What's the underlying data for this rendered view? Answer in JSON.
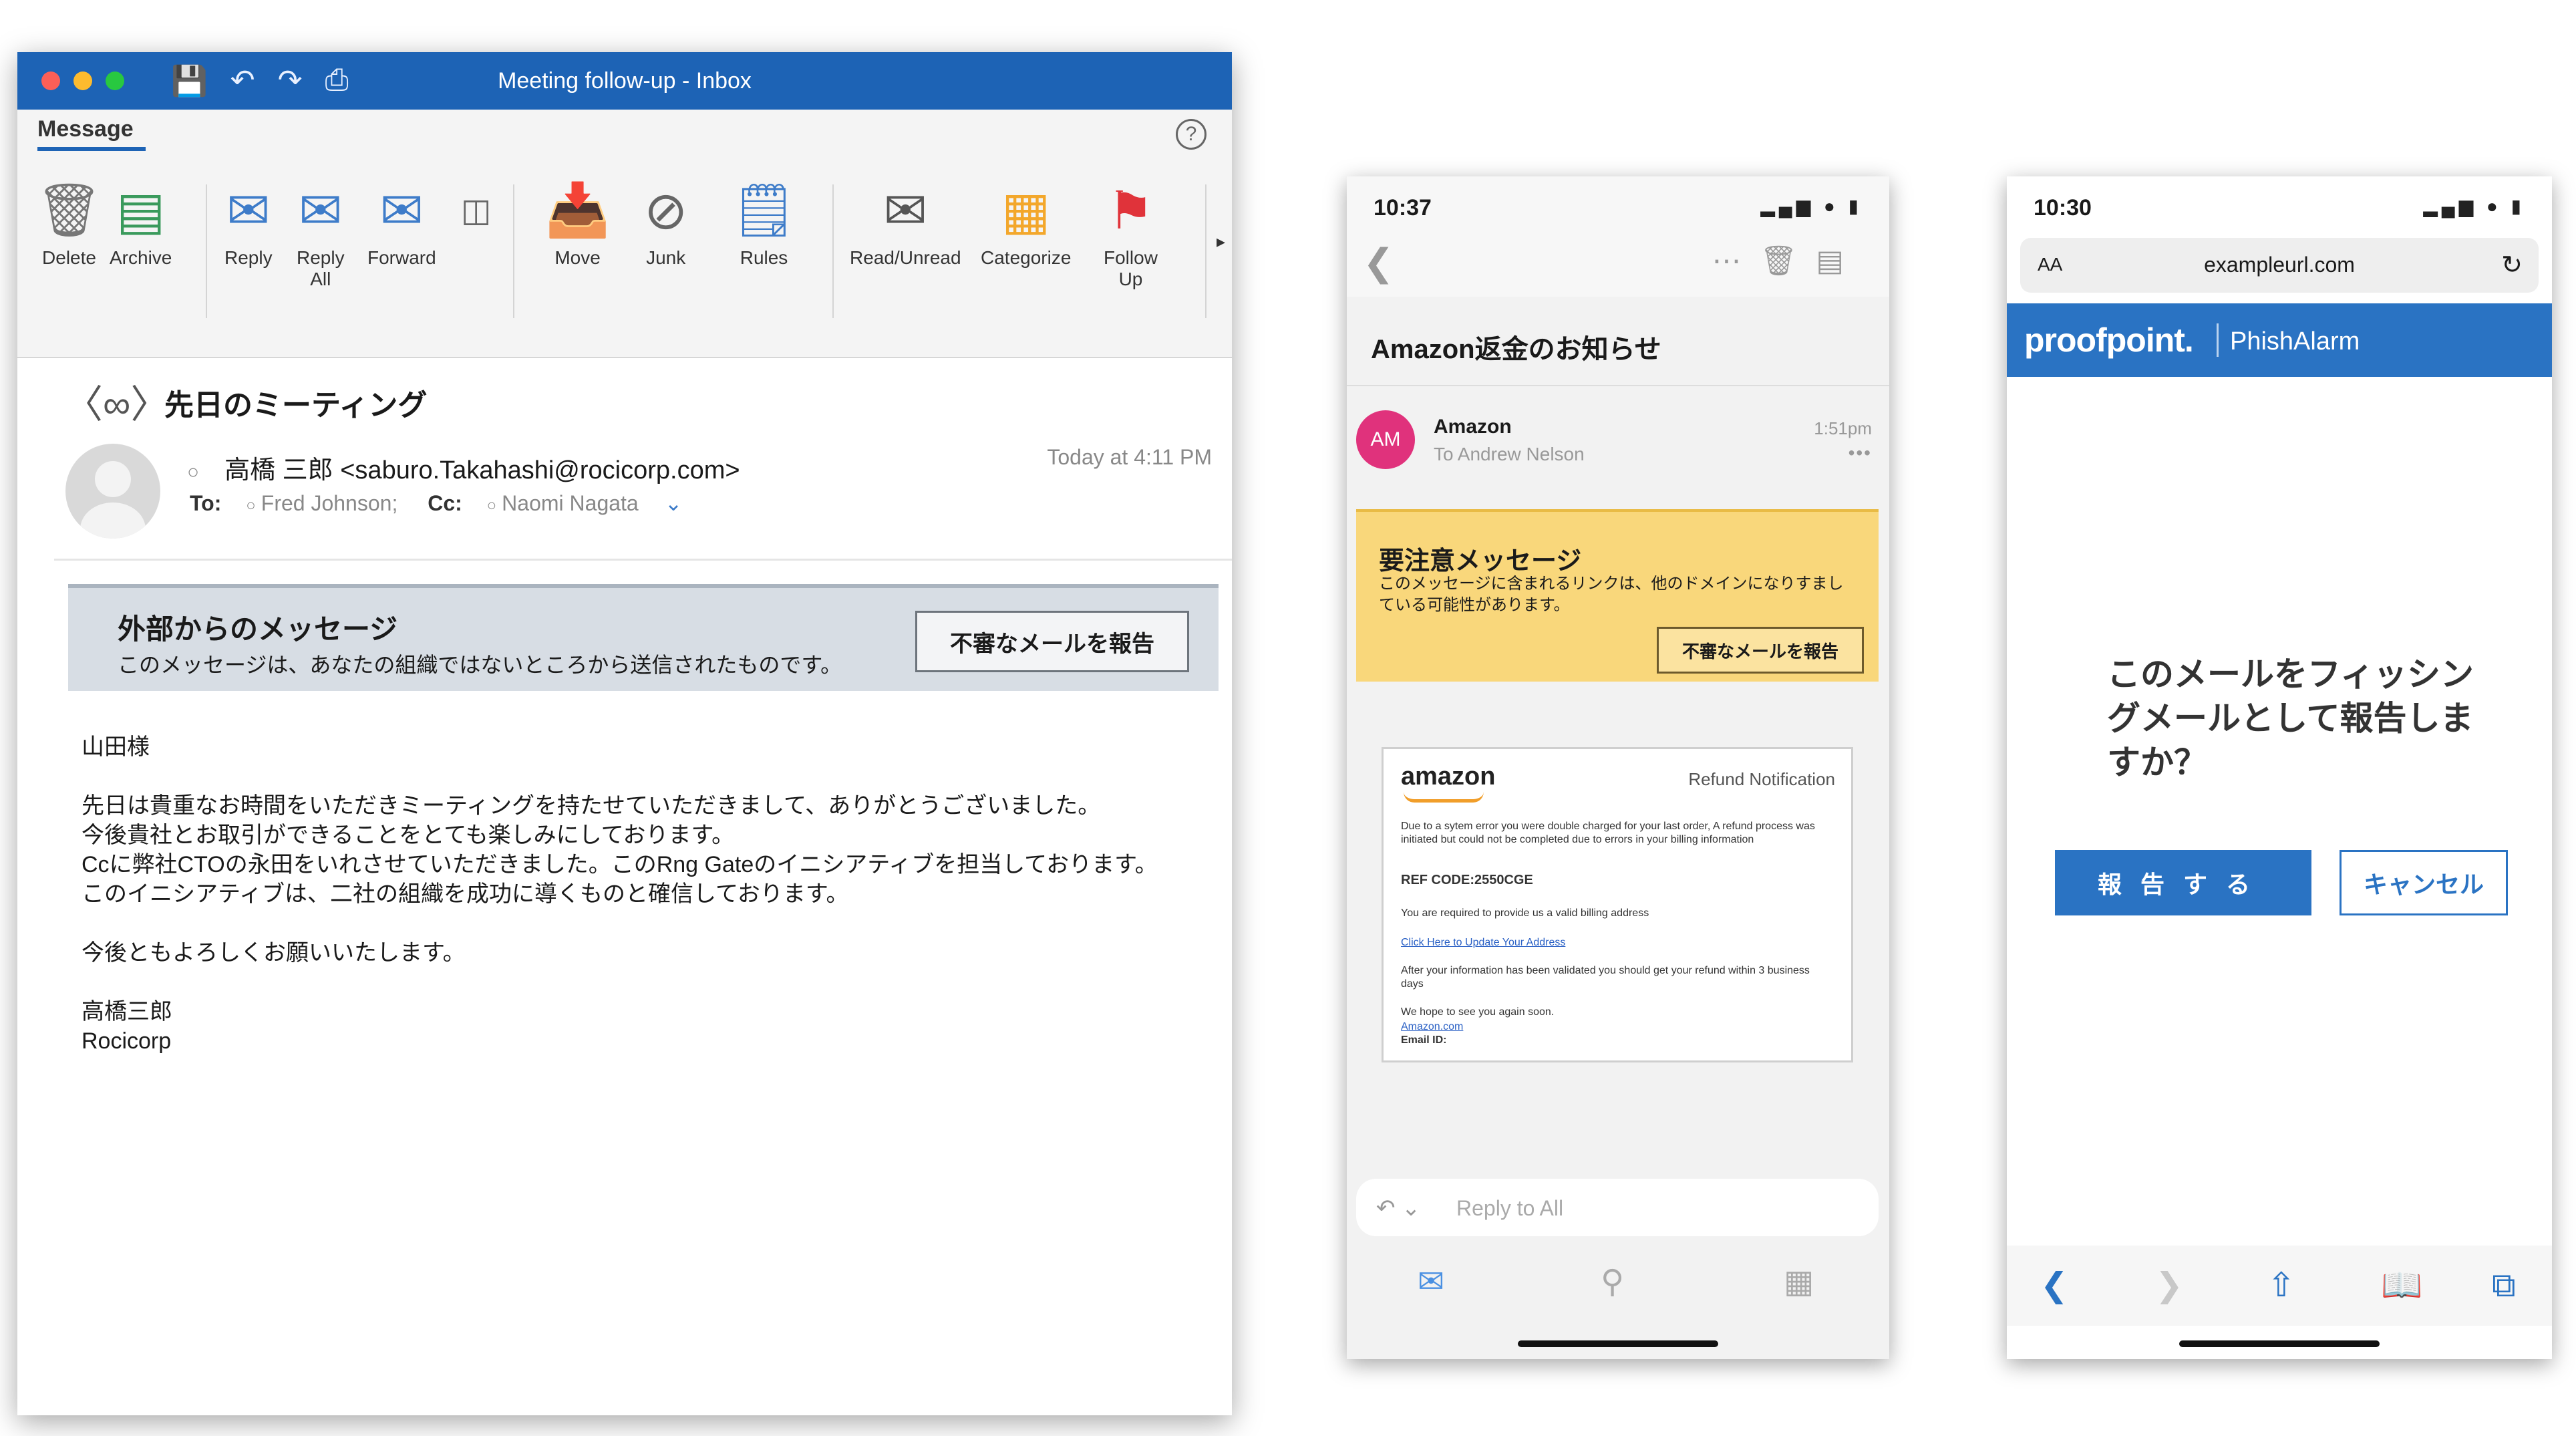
{
  "outlook": {
    "window_title": "Meeting follow-up - Inbox",
    "tab_message": "Message",
    "ribbon": {
      "delete": "Delete",
      "archive": "Archive",
      "reply": "Reply",
      "reply_all_1": "Reply",
      "reply_all_2": "All",
      "forward": "Forward",
      "move": "Move",
      "junk": "Junk",
      "rules": "Rules",
      "read_unread": "Read/Unread",
      "categorize": "Categorize",
      "follow_up_1": "Follow",
      "follow_up_2": "Up"
    },
    "subject": "先日のミーティング",
    "sender": "高橋 三郎 <saburo.Takahashi@rocicorp.com>",
    "to_label": "To:",
    "to_name": "Fred Johnson;",
    "cc_label": "Cc:",
    "cc_name": "Naomi Nagata",
    "date": "Today at 4:11 PM",
    "banner": {
      "title": "外部からのメッセージ",
      "text": "このメッセージは、あなたの組織ではないところから送信されたものです。",
      "button": "不審なメールを報告"
    },
    "body": {
      "greeting": "山田様",
      "line1": "先日は貴重なお時間をいただきミーティングを持たせていただきまして、ありがとうございました。",
      "line2": "今後貴社とお取引ができることをとても楽しみにしております。",
      "line3": "Ccに弊社CTOの永田をいれさせていただきました。このRng Gateのイニシアティブを担当しております。",
      "line4": "このイニシアティブは、二社の組織を成功に導くものと確信しております。",
      "closing": "今後ともよろしくお願いいたします。",
      "sig_name": "高橋三郎",
      "sig_company": "Rocicorp"
    }
  },
  "phone1": {
    "time": "10:37",
    "subject": "Amazon返金のお知らせ",
    "avatar_initials": "AM",
    "from": "Amazon",
    "to": "To Andrew Nelson",
    "time_received": "1:51pm",
    "warning": {
      "title": "要注意メッセージ",
      "text": "このメッセージに含まれるリンクは、他のドメインになりすましている可能性があります。",
      "button": "不審なメールを報告"
    },
    "email_card": {
      "logo": "amazon",
      "header": "Refund Notification",
      "p1": "Due to a sytem error you were double charged for your last order, A refund process was initiated but could not be completed due to errors in your billing information",
      "ref": "REF CODE:2550CGE",
      "p2": "You are required to provide us a valid billing address",
      "link": "Click Here to Update Your Address",
      "p3": "After your information has been validated you should get your refund within 3 business days",
      "p4": "We hope to see you again soon.",
      "sig": "Amazon.com",
      "email_label": "Email ID:"
    },
    "reply_label": "Reply to All"
  },
  "phone2": {
    "time": "10:30",
    "aa": "AA",
    "domain": "exampleurl.com",
    "brand": "proofpoint.",
    "product": "PhishAlarm",
    "question": "このメールをフィッシングメールとして報告しますか？",
    "report_button": "報告する",
    "cancel_button": "キャンセル"
  }
}
